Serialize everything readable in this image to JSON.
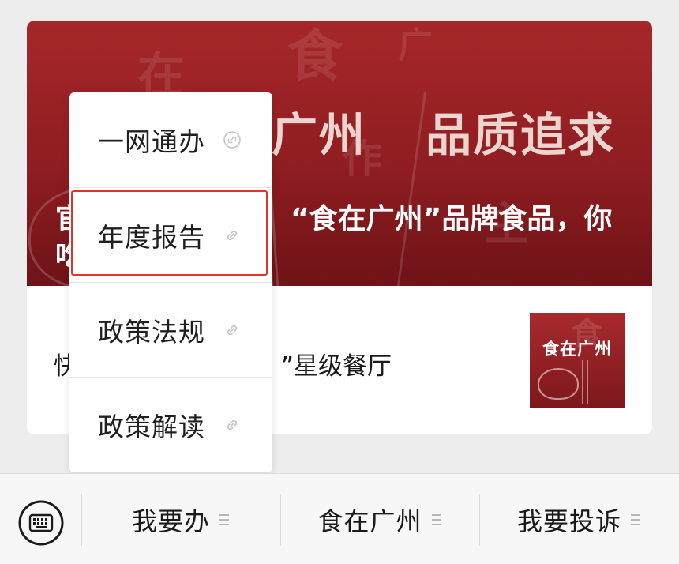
{
  "article": {
    "banner_headline_left": "在广州",
    "banner_headline_right": "品质追求",
    "banner_subtitle": "“食在广州”品牌食品，你",
    "banner_subtitle_prefix_1": "官",
    "banner_subtitle_prefix_2": "吃",
    "caption_prefix": "快",
    "caption_suffix": "”星级餐厅",
    "thumbnail_text": "食在广州",
    "colors": {
      "banner_red": "#a6272a",
      "banner_dark": "#6e1317"
    }
  },
  "popup": {
    "items": [
      {
        "label": "一网通办",
        "icon": "link-icon"
      },
      {
        "label": "年度报告",
        "icon": "link-icon",
        "selected": true
      },
      {
        "label": "政策法规",
        "icon": "link-icon"
      },
      {
        "label": "政策解读",
        "icon": "link-icon"
      }
    ],
    "highlight_color": "#e5322d"
  },
  "bottom_bar": {
    "keyboard_icon": "keyboard-icon",
    "menus": [
      {
        "label": "我要办",
        "icon": "menu-lines-icon"
      },
      {
        "label": "食在广州",
        "icon": "menu-lines-icon"
      },
      {
        "label": "我要投诉",
        "icon": "menu-lines-icon"
      }
    ]
  }
}
